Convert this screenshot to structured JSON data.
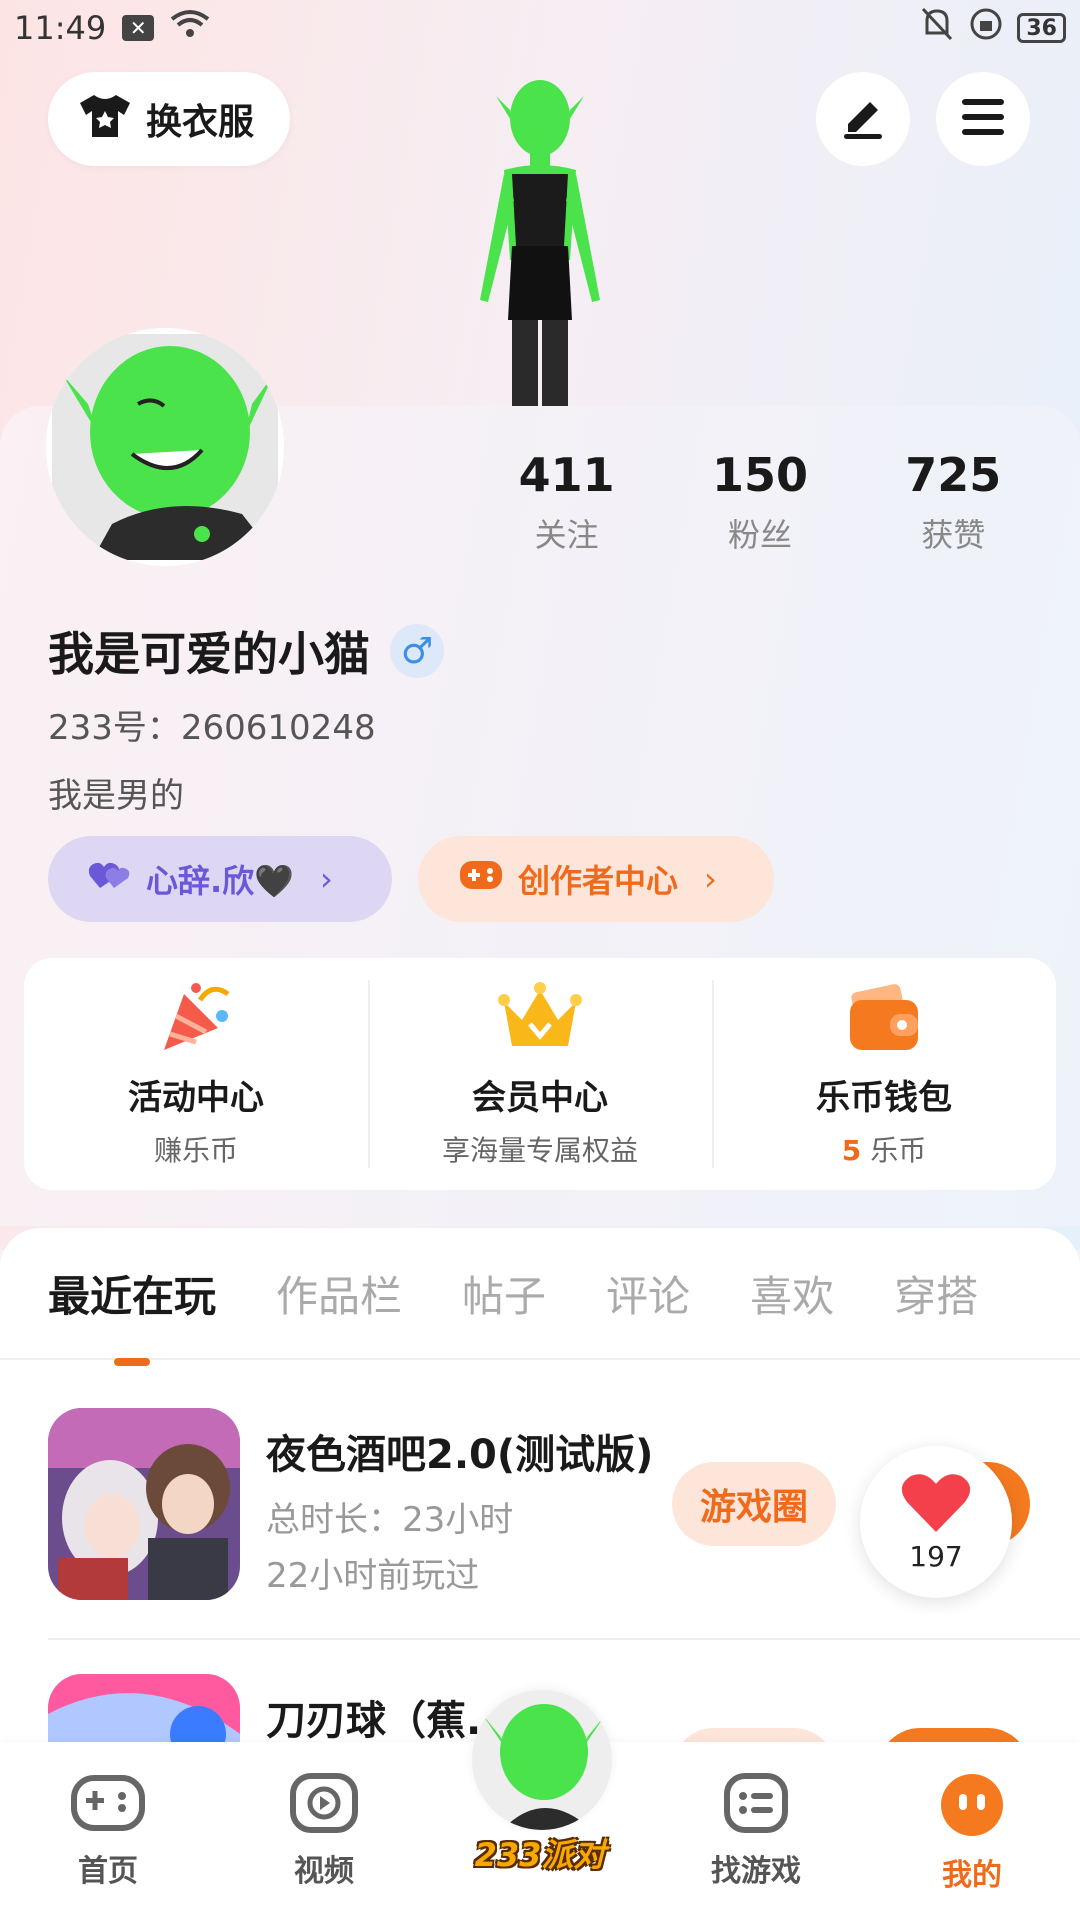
{
  "status_bar": {
    "time": "11:49",
    "battery": "36"
  },
  "header": {
    "outfit_label": "换衣服"
  },
  "profile": {
    "stats": [
      {
        "value": "411",
        "label": "关注"
      },
      {
        "value": "150",
        "label": "粉丝"
      },
      {
        "value": "725",
        "label": "获赞"
      }
    ],
    "username": "我是可爱的小猫",
    "gender_symbol": "♂",
    "uid": "233号：260610248",
    "bio": "我是男的"
  },
  "pills": {
    "group_label": "心辞.欣🖤",
    "creator_label": "创作者中心"
  },
  "features": [
    {
      "title": "活动中心",
      "sub": "赚乐币"
    },
    {
      "title": "会员中心",
      "sub": "享海量专属权益"
    },
    {
      "title": "乐币钱包",
      "sub_value": "5",
      "sub": "乐币"
    }
  ],
  "tabs": [
    "最近在玩",
    "作品栏",
    "帖子",
    "评论",
    "喜欢",
    "穿搭"
  ],
  "games": [
    {
      "title": "夜色酒吧2.0(测试版)",
      "duration": "总时长：23小时",
      "last_played": "22小时前玩过",
      "circle_label": "游戏圈"
    },
    {
      "title": "刀刃球（蕉..."
    }
  ],
  "like_float": {
    "count": "197"
  },
  "bottom_nav": {
    "items": [
      "首页",
      "视频",
      "找游戏",
      "我的"
    ],
    "center_label": "233派对"
  },
  "colors": {
    "accent": "#f06a1c",
    "group": "#6a58d6"
  }
}
